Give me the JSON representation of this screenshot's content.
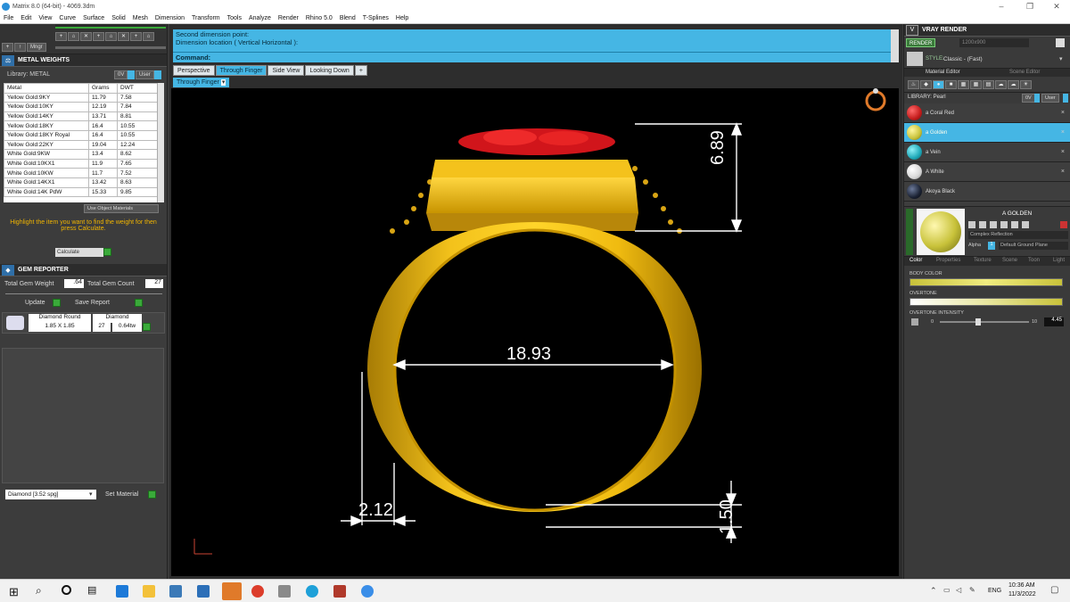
{
  "window": {
    "title": "Matrix 8.0 (64-bit) - 4069.3dm",
    "min": "–",
    "max": "❐",
    "close": "✕"
  },
  "menu": [
    "File",
    "Edit",
    "View",
    "Curve",
    "Surface",
    "Solid",
    "Mesh",
    "Dimension",
    "Transform",
    "Tools",
    "Analyze",
    "Render",
    "Rhino 5.0",
    "Blend",
    "T-Splines",
    "Help"
  ],
  "left": {
    "toolbar_label": "Mngr",
    "metal_weights": {
      "title": "METAL WEIGHTS",
      "library_label": "Library: METAL",
      "lib_btn": "0V",
      "user_btn": "User",
      "columns": [
        "Metal",
        "Grams",
        "DWT"
      ],
      "rows": [
        [
          "Yellow Gold:9KY",
          "11.79",
          "7.58"
        ],
        [
          "Yellow Gold:10KY",
          "12.19",
          "7.84"
        ],
        [
          "Yellow Gold:14KY",
          "13.71",
          "8.81"
        ],
        [
          "Yellow Gold:18KY",
          "16.4",
          "10.55"
        ],
        [
          "Yellow Gold:18KY Royal",
          "16.4",
          "10.55"
        ],
        [
          "Yellow Gold:22KY",
          "19.04",
          "12.24"
        ],
        [
          "White Gold:9KW",
          "13.4",
          "8.62"
        ],
        [
          "White Gold:10KX1",
          "11.9",
          "7.65"
        ],
        [
          "White Gold:10KW",
          "11.7",
          "7.52"
        ],
        [
          "White Gold:14KX1",
          "13.42",
          "8.63"
        ],
        [
          "White Gold:14K PdW",
          "15.33",
          "9.85"
        ]
      ],
      "use_object_materials": "Use Object Materials",
      "hint": "Highlight the item you want to find the weight for then press Calculate.",
      "calculate": "Calculate"
    },
    "gem_reporter": {
      "title": "GEM REPORTER",
      "total_weight_label": "Total Gem Weight",
      "total_weight": ".64",
      "total_count_label": "Total Gem Count",
      "total_count": "27",
      "update": "Update",
      "save_report": "Save Report",
      "gem": {
        "shape": "Diamond Round",
        "size": "1.85 X 1.85",
        "material": "Diamond",
        "count": "27",
        "weight": "0.64tw"
      }
    },
    "material_select": "Diamond   [3.52 spg]",
    "set_material": "Set Material"
  },
  "command": {
    "line1": "Second dimension point:",
    "line2": "Dimension location ( Vertical  Horizontal ):",
    "prompt": "Command:"
  },
  "viewport_tabs": [
    {
      "label": "Perspective",
      "active": false
    },
    {
      "label": "Through Finger",
      "active": true
    },
    {
      "label": "Side View",
      "active": false
    },
    {
      "label": "Looking Down",
      "active": false
    }
  ],
  "viewport_label": "Through Finger",
  "dimensions": {
    "inner_diameter": "18.93",
    "top_height": "6.89",
    "shank_width": "2.12",
    "shank_thickness": "1.50"
  },
  "right": {
    "title": "VRAY RENDER",
    "render_btn": "RENDER",
    "resolution": "1200x900",
    "style_label": "STYLE:",
    "style_value": "Classic - (Fast)",
    "tabs": [
      "Material Editor",
      "Scene Editor"
    ],
    "library_label": "LIBRARY: Pearl",
    "lib_btn": "0V",
    "user_btn": "User",
    "materials": [
      {
        "name": "a Coral Red",
        "color": "#c41c1c"
      },
      {
        "name": "a Golden",
        "color": "#c8c23a"
      },
      {
        "name": "a Vein",
        "color": "#1ea8b8"
      },
      {
        "name": "A White",
        "color": "#d8d8d8"
      },
      {
        "name": "Akoya Black",
        "color": "#1b2233"
      }
    ],
    "selected_material": "A GOLDEN",
    "reflection": "Complex Reflection",
    "alpha_label": "Alpha",
    "alpha_value": "1",
    "ground": "Default Ground Plane",
    "prop_tabs": [
      "Color",
      "Properties",
      "Texture",
      "Scene",
      "Toon",
      "Light"
    ],
    "body_color_label": "BODY COLOR",
    "overtone_label": "OVERTONE",
    "overtone_intensity_label": "OVERTONE INTENSITY",
    "intensity_min": "0",
    "intensity_max": "10",
    "intensity_value": "4.45",
    "accent": "#45b6e4"
  },
  "taskbar": {
    "time": "10:36 AM",
    "date": "11/3/2022",
    "lang": "ENG"
  }
}
